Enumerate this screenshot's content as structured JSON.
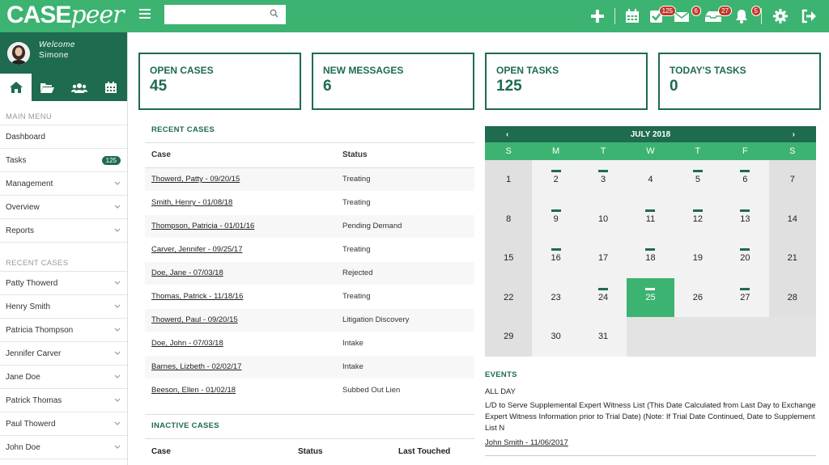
{
  "brand": {
    "logo_case": "CASE",
    "logo_peer": "peer"
  },
  "search": {
    "placeholder": ""
  },
  "topbar": {
    "tasks_badge": "125",
    "messages_badge": "6",
    "inbox_badge": "27",
    "notifications_badge": "5"
  },
  "user": {
    "welcome": "Welcome",
    "name": "Simone"
  },
  "sidebar": {
    "main_menu_title": "MAIN MENU",
    "main_items": [
      {
        "label": "Dashboard"
      },
      {
        "label": "Tasks",
        "badge": "125"
      },
      {
        "label": "Management"
      },
      {
        "label": "Overview"
      },
      {
        "label": "Reports"
      }
    ],
    "recent_title": "RECENT CASES",
    "recent_items": [
      "Patty Thowerd",
      "Henry Smith",
      "Patricia Thompson",
      "Jennifer Carver",
      "Jane Doe",
      "Patrick Thomas",
      "Paul Thowerd",
      "John Doe"
    ]
  },
  "stats": [
    {
      "label": "OPEN CASES",
      "value": "45"
    },
    {
      "label": "NEW MESSAGES",
      "value": "6"
    },
    {
      "label": "OPEN TASKS",
      "value": "125"
    },
    {
      "label": "TODAY'S TASKS",
      "value": "0"
    }
  ],
  "recent_cases": {
    "title": "RECENT CASES",
    "col_case": "Case",
    "col_status": "Status",
    "rows": [
      {
        "case": "Thowerd, Patty - 09/20/15",
        "status": "Treating"
      },
      {
        "case": "Smith, Henry - 01/08/18",
        "status": "Treating"
      },
      {
        "case": "Thompson, Patricia - 01/01/16",
        "status": "Pending Demand"
      },
      {
        "case": "Carver, Jennifer - 09/25/17",
        "status": "Treating"
      },
      {
        "case": "Doe, Jane - 07/03/18",
        "status": "Rejected"
      },
      {
        "case": "Thomas, Patrick - 11/18/16",
        "status": "Treating"
      },
      {
        "case": "Thowerd, Paul - 09/20/15",
        "status": "Litigation Discovery"
      },
      {
        "case": "Doe, John - 07/03/18",
        "status": "Intake"
      },
      {
        "case": "Barnes, Lizbeth - 02/02/17",
        "status": "Intake"
      },
      {
        "case": "Beeson, Ellen - 01/02/18",
        "status": "Subbed Out Lien"
      }
    ]
  },
  "inactive_cases": {
    "title": "INACTIVE CASES",
    "col_case": "Case",
    "col_status": "Status",
    "col_last": "Last Touched"
  },
  "calendar": {
    "month": "JULY 2018",
    "prev": "‹",
    "next": "›",
    "weekdays": [
      "S",
      "M",
      "T",
      "W",
      "T",
      "F",
      "S"
    ],
    "days": [
      1,
      2,
      3,
      4,
      5,
      6,
      7,
      8,
      9,
      10,
      11,
      12,
      13,
      14,
      15,
      16,
      17,
      18,
      19,
      20,
      21,
      22,
      23,
      24,
      25,
      26,
      27,
      28,
      29,
      30,
      31
    ],
    "event_days": [
      2,
      3,
      5,
      6,
      9,
      11,
      12,
      13,
      16,
      18,
      20,
      24,
      25,
      27
    ],
    "today": 25
  },
  "events": {
    "title": "EVENTS",
    "all_day": "ALL DAY",
    "description": "L/D to Serve Supplemental Expert Witness List (This Date Calculated from Last Day to Exchange Expert Witness Information prior to Trial Date) (Note: If Trial Date Continued, Date to Supplement List N",
    "link": "John Smith - 11/06/2017"
  },
  "colors": {
    "brand_green": "#3cb371",
    "dark_green": "#1e6b4f",
    "badge_red": "#c0392b"
  }
}
